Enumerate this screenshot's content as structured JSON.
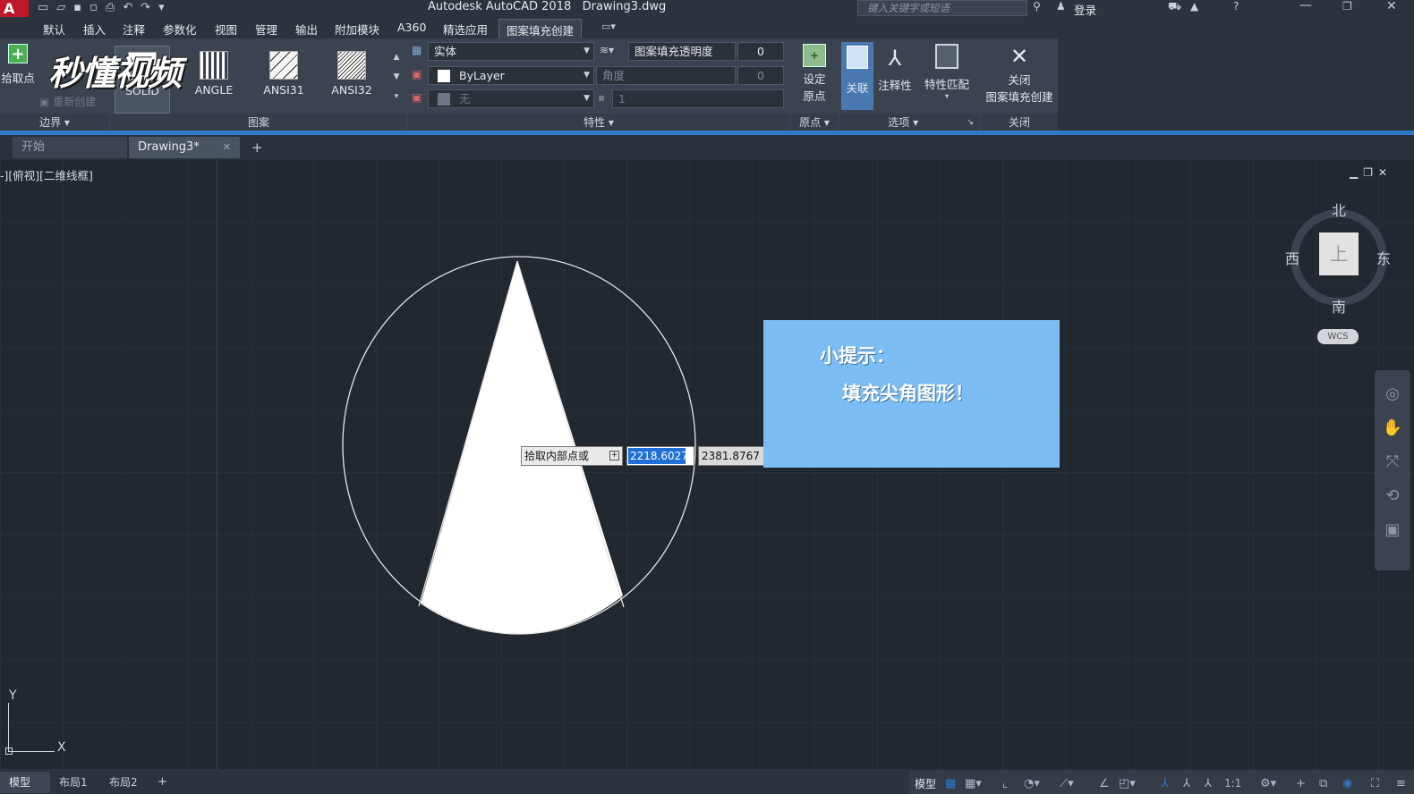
{
  "title_bar": {
    "app_title": "Autodesk AutoCAD 2018",
    "file_name": "Drawing3.dwg",
    "search_placeholder": "键入关键字或短语",
    "login_label": "登录"
  },
  "menu": [
    "默认",
    "插入",
    "注释",
    "参数化",
    "视图",
    "管理",
    "输出",
    "附加模块",
    "A360",
    "精选应用",
    "图案填充创建"
  ],
  "ribbon": {
    "boundary": {
      "pick_points_label": "拾取点",
      "recreate_label": "重新创建",
      "footer": "边界"
    },
    "pattern": {
      "items": [
        "SOLID",
        "ANGLE",
        "ANSI31",
        "ANSI32"
      ],
      "footer": "图案"
    },
    "properties": {
      "type_value": "实体",
      "transparency_label": "图案填充透明度",
      "transparency_value": "0",
      "color_value": "ByLayer",
      "angle_label": "角度",
      "angle_value": "0",
      "background_value": "无",
      "scale_value": "1",
      "footer": "特性"
    },
    "origin": {
      "set_origin_line1": "设定",
      "set_origin_line2": "原点",
      "footer": "原点"
    },
    "options": {
      "associative": "关联",
      "annotative": "注释性",
      "match_props": "特性匹配",
      "footer": "选项"
    },
    "close": {
      "line1": "关闭",
      "line2": "图案填充创建",
      "footer": "关闭"
    }
  },
  "watermark": "秒懂视频",
  "file_tabs": {
    "start": "开始",
    "drawing": "Drawing3*",
    "new_tab": "+"
  },
  "viewport": {
    "view_label": "-][俯视][二维线框]",
    "viewcube": {
      "north": "北",
      "south": "南",
      "east": "东",
      "west": "西",
      "top": "上",
      "wcs": "WCS"
    },
    "ucs": {
      "x": "X",
      "y": "Y"
    }
  },
  "command_tooltip": {
    "prompt": "拾取内部点或",
    "x_value": "2218.6027",
    "y_value": "2381.8767"
  },
  "tip_box": {
    "heading": "小提示：",
    "body": "填充尖角图形！"
  },
  "layout_tabs": [
    "模型",
    "布局1",
    "布局2",
    "+"
  ],
  "status_bar": {
    "model_label": "模型",
    "scale": "1:1"
  },
  "colors": {
    "accent": "#2d78c8",
    "tip_bg": "#7bbcf4",
    "canvas": "#212830"
  }
}
